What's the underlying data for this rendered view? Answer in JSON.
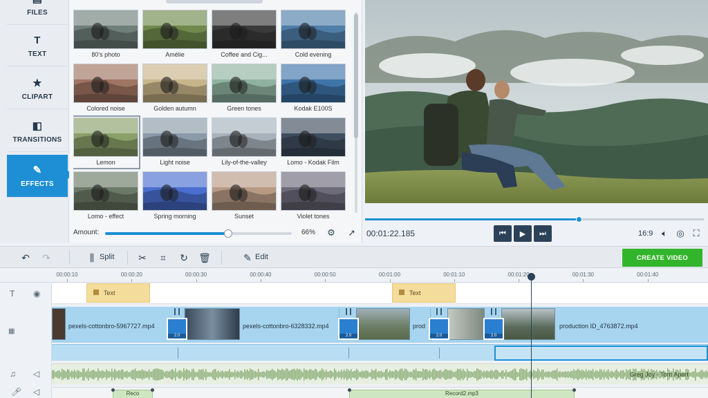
{
  "sidebar": {
    "items": [
      {
        "label": "FILES",
        "icon": "files-icon"
      },
      {
        "label": "TEXT",
        "icon": "text-icon"
      },
      {
        "label": "CLIPART",
        "icon": "star-icon"
      },
      {
        "label": "TRANSITIONS",
        "icon": "transitions-icon"
      },
      {
        "label": "EFFECTS",
        "icon": "effects-icon",
        "active": true
      }
    ]
  },
  "effects": {
    "items": [
      {
        "label": "80's photo",
        "tint": "#6f7f7a"
      },
      {
        "label": "Amélie",
        "tint": "#6f8a4c"
      },
      {
        "label": "Coffee and Cig...",
        "tint": "#3a3a3a"
      },
      {
        "label": "Cold evening",
        "tint": "#4f7ea8"
      },
      {
        "label": "Colored noise",
        "tint": "#a07462"
      },
      {
        "label": "Golden autumn",
        "tint": "#c8b48a"
      },
      {
        "label": "Green tones",
        "tint": "#8fb2a0"
      },
      {
        "label": "Kodak E100S",
        "tint": "#3f74a8"
      },
      {
        "label": "Lemon",
        "tint": "#8aa06a",
        "selected": true
      },
      {
        "label": "Light noise",
        "tint": "#8a9aa8"
      },
      {
        "label": "Lily-of-the-valley",
        "tint": "#a7b2bd"
      },
      {
        "label": "Lomo - Kodak Film",
        "tint": "#3f4e5e"
      },
      {
        "label": "Lomo - effect",
        "tint": "#6b7a66"
      },
      {
        "label": "Spring morning",
        "tint": "#4a6fd0"
      },
      {
        "label": "Sunset",
        "tint": "#b89a84"
      },
      {
        "label": "Violet tones",
        "tint": "#6d6a7a"
      }
    ],
    "amount_label": "Amount:",
    "amount_value": "66%",
    "amount_fraction": 0.66
  },
  "preview": {
    "time": "00:01:22.185",
    "progress_fraction": 0.63,
    "aspect": "16:9"
  },
  "toolbar": {
    "split_label": "Split",
    "edit_label": "Edit",
    "create_label": "CREATE VIDEO"
  },
  "ruler": {
    "ticks": [
      "00:00:10",
      "00:00:20",
      "00:00:30",
      "00:00:40",
      "00:00:50",
      "00:01:00",
      "00:01:10",
      "00:01:20",
      "00:01:30",
      "00:01:40"
    ]
  },
  "timeline": {
    "text_clips": [
      "Text",
      "Text"
    ],
    "video_clips": [
      "pexels-cottonbro-5967727.mp4",
      "pexels-cottonbro-6328332.mp4",
      "prod",
      "production ID_4763872.mp4"
    ],
    "transition_value": "2.0",
    "music_name": "Greg Joy - Torn Apart",
    "voice_clips": [
      "Reco",
      "Record2.mp3"
    ]
  },
  "colors": {
    "accent": "#1e8fd5",
    "create_button": "#33b52b",
    "dark_control": "#2c4258"
  }
}
